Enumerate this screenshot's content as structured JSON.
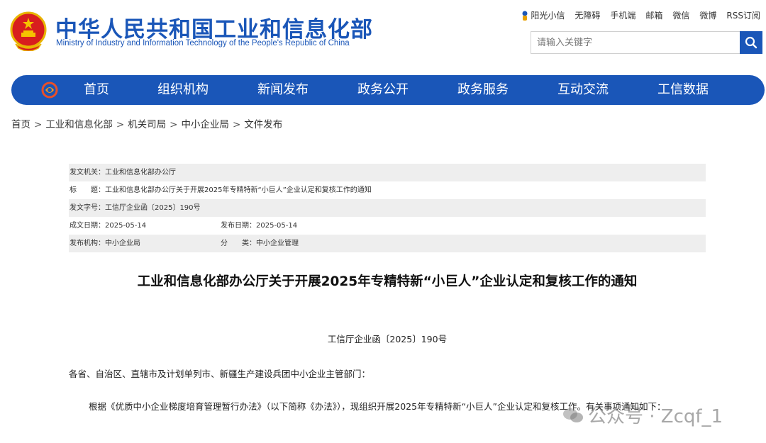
{
  "header": {
    "title": "中华人民共和国工业和信息化部",
    "subtitle": "Ministry of Industry and Information Technology of the People's Republic of China",
    "toplinks": [
      "阳光小信",
      "无障碍",
      "手机端",
      "邮箱",
      "微信",
      "微博",
      "RSS订阅"
    ]
  },
  "search": {
    "placeholder": "请输入关键字"
  },
  "nav": {
    "items": [
      "首页",
      "组织机构",
      "新闻发布",
      "政务公开",
      "政务服务",
      "互动交流",
      "工信数据"
    ]
  },
  "breadcrumb": [
    "首页",
    "工业和信息化部",
    "机关司局",
    "中小企业局",
    "文件发布"
  ],
  "meta": {
    "issuer": "发文机关：工业和信息化部办公厅",
    "subject": "标　　题：工业和信息化部办公厅关于开展2025年专精特新“小巨人”企业认定和复核工作的通知",
    "doc_no": "发文字号：工信厅企业函〔2025〕190号",
    "created": "成文日期：2025-05-14",
    "published": "发布日期：2025-05-14",
    "org": "发布机构：中小企业局",
    "category": "分　　类：中小企业管理"
  },
  "document": {
    "title": "工业和信息化部办公厅关于开展2025年专精特新“小巨人”企业认定和复核工作的通知",
    "number": "工信厅企业函〔2025〕190号",
    "addressee": "各省、自治区、直辖市及计划单列市、新疆生产建设兵团中小企业主管部门：",
    "paragraph": "根据《优质中小企业梯度培育管理暂行办法》（以下简称《办法》），现组织开展2025年专精特新“小巨人”企业认定和复核工作。有关事项通知如下："
  },
  "watermark": {
    "text": "公众号 · Zcqf_1"
  },
  "colors": {
    "brand_blue": "#1a56b8",
    "meta_shade": "#eeeeee"
  }
}
